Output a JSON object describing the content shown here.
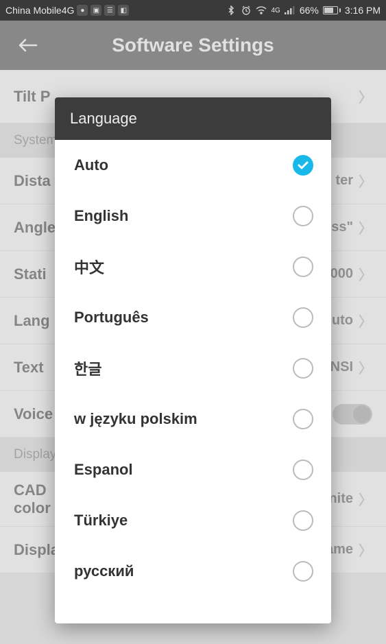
{
  "statusbar": {
    "carrier": "China Mobile4G",
    "battery_pct": "66%",
    "time": "3:16 PM",
    "net_label": "4G"
  },
  "header": {
    "title": "Software Settings"
  },
  "settings": {
    "row0_label": "Tilt P",
    "section_system": "System",
    "dista_label": "Dista",
    "dista_value": "ter",
    "angle_label": "Angle",
    "angle_value": "ss\"",
    "stati_label": "Stati",
    "stati_value": "000",
    "lang_label": "Lang",
    "lang_value": "uto",
    "text_label": "Text",
    "text_value": "NSI",
    "voice_label": "Voice",
    "section_display": "Display",
    "cad_label_l1": "CAD",
    "cad_label_l2": "color",
    "cad_value": "nite",
    "display_content_label": "Display Content",
    "display_content_value": "Point Name"
  },
  "dialog": {
    "title": "Language",
    "options": [
      {
        "label": "Auto",
        "selected": true
      },
      {
        "label": "English",
        "selected": false
      },
      {
        "label": "中文",
        "selected": false
      },
      {
        "label": "Português",
        "selected": false
      },
      {
        "label": "한글",
        "selected": false
      },
      {
        "label": "w języku polskim",
        "selected": false
      },
      {
        "label": "Espanol",
        "selected": false
      },
      {
        "label": "Türkiye",
        "selected": false
      },
      {
        "label": "русский",
        "selected": false
      }
    ]
  }
}
